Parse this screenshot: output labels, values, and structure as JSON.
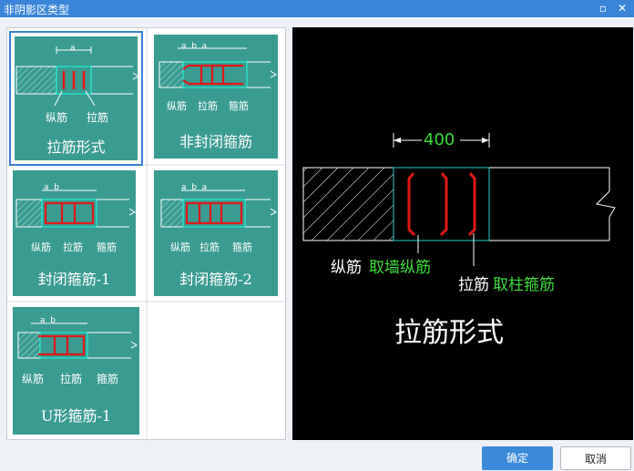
{
  "window": {
    "title": "非阴影区类型",
    "maximize_glyph": "▫",
    "close_glyph": "✕"
  },
  "gallery": {
    "items": [
      {
        "label": "拉筋形式",
        "selected": true,
        "dim": "a",
        "annotations": [
          "纵筋",
          "拉筋"
        ]
      },
      {
        "label": "非封闭箍筋",
        "selected": false,
        "dim": "a  b  a",
        "annotations": [
          "纵筋",
          "拉筋",
          "箍筋"
        ]
      },
      {
        "label": "封闭箍筋-1",
        "selected": false,
        "dim": "a  b",
        "annotations": [
          "纵筋",
          "拉筋",
          "箍筋"
        ]
      },
      {
        "label": "封闭箍筋-2",
        "selected": false,
        "dim": "a  b  a",
        "annotations": [
          "纵筋",
          "拉筋",
          "箍筋"
        ]
      },
      {
        "label": "U形箍筋-1",
        "selected": false,
        "dim": "a  b",
        "annotations": [
          "纵筋",
          "拉筋",
          "箍筋"
        ]
      }
    ]
  },
  "preview": {
    "dimension": "400",
    "label_rebar_white": "纵筋",
    "label_rebar_green": "取墙纵筋",
    "label_tie_white": "拉筋",
    "label_tie_green": "取柱箍筋",
    "caption": "拉筋形式"
  },
  "buttons": {
    "ok": "确定",
    "cancel": "取消"
  },
  "colors": {
    "title_bar": "#3a85d8",
    "card": "#3a9b91",
    "rebar_red": "#e01818",
    "dim_green": "#3cdc3c",
    "outline_cyan": "#22cccc"
  }
}
